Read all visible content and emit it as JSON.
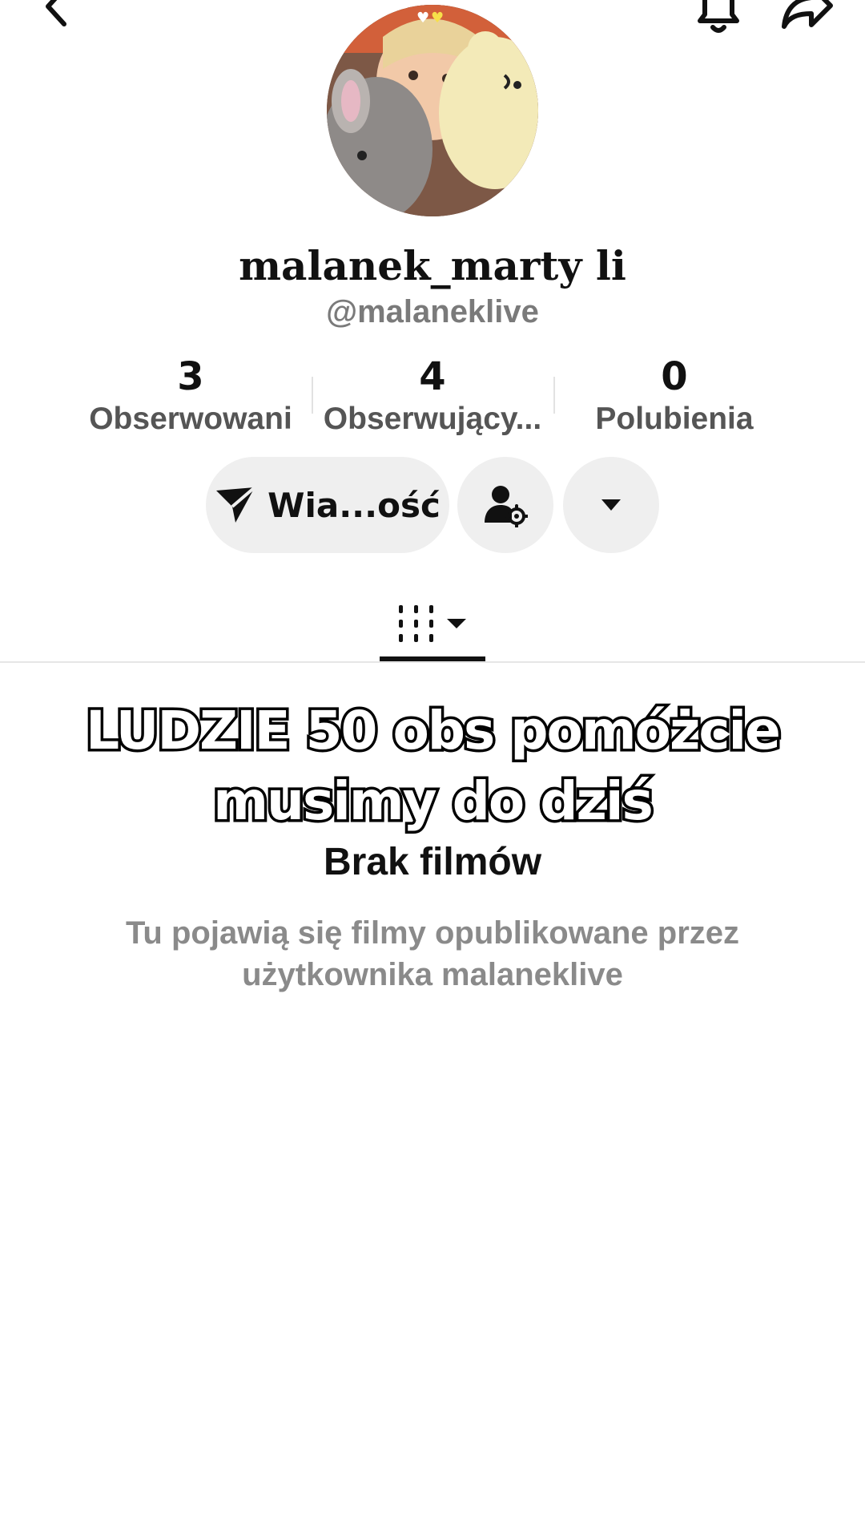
{
  "header": {
    "back_icon": "chevron-left-icon",
    "bell_icon": "bell-icon",
    "share_icon": "share-arrow-icon"
  },
  "profile": {
    "display_name": "malanek_marty li",
    "handle": "@malaneklive"
  },
  "stats": [
    {
      "value": "3",
      "label": "Obserwowani"
    },
    {
      "value": "4",
      "label": "Obserwujący..."
    },
    {
      "value": "0",
      "label": "Polubienia"
    }
  ],
  "actions": {
    "message_label": "Wia...ość",
    "message_icon": "send-icon",
    "add_friend_icon": "user-settings-icon",
    "more_icon": "caret-down-icon"
  },
  "tabs": {
    "videos_icon": "grid-icon"
  },
  "overlay": {
    "line1": "LUDZIE 50 obs pomóżcie",
    "line2": "musimy do dziś"
  },
  "empty_state": {
    "title": "Brak filmów",
    "description": "Tu pojawią się filmy opublikowane przez użytkownika malaneklive"
  },
  "colors": {
    "button_bg": "#efefef",
    "text_primary": "#111111",
    "text_secondary": "#8a8a8a"
  }
}
